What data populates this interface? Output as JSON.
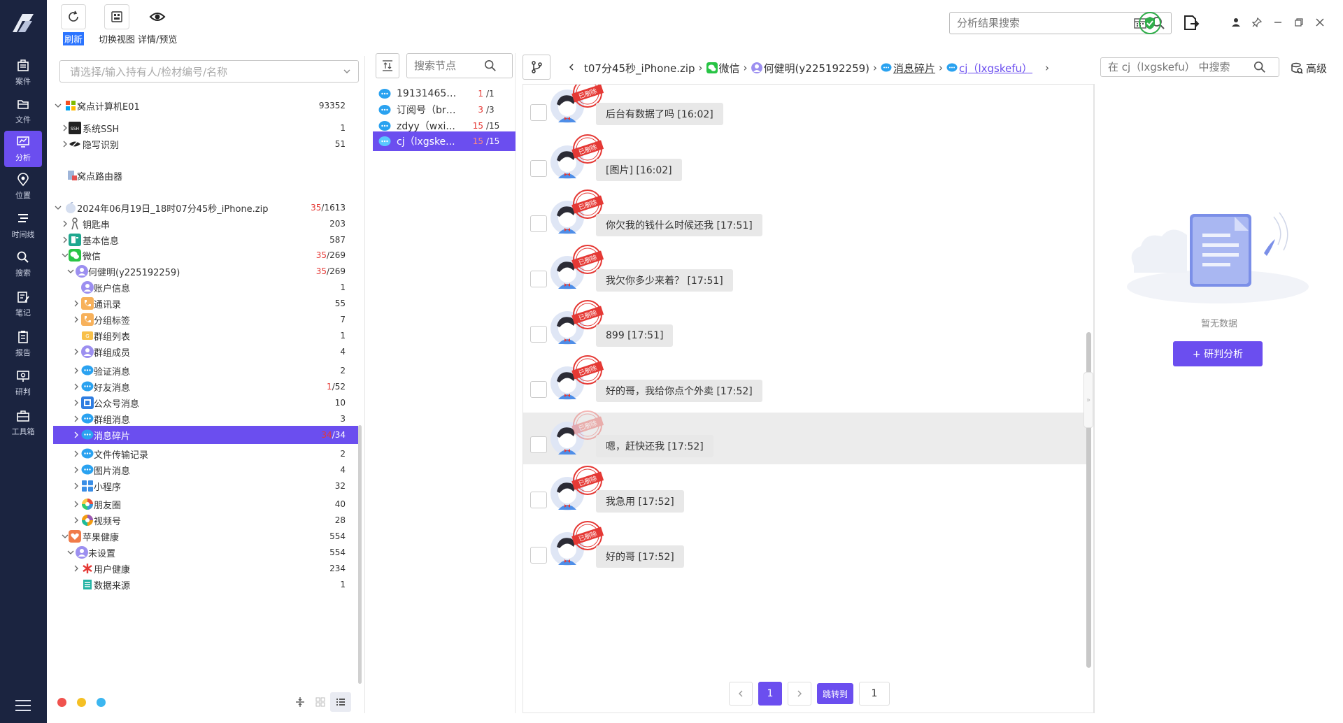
{
  "toolbar": {
    "refresh_label": "刷新",
    "switch_view_label": "切换视图",
    "detail_preview_label": "详情/预览",
    "result_search_placeholder": "分析结果搜索"
  },
  "nav": {
    "items": [
      {
        "label": "案件",
        "icon": "briefcase-icon"
      },
      {
        "label": "文件",
        "icon": "folder-icon"
      },
      {
        "label": "分析",
        "icon": "chart-monitor-icon"
      },
      {
        "label": "位置",
        "icon": "location-pin-icon"
      },
      {
        "label": "时间线",
        "icon": "timeline-icon"
      },
      {
        "label": "搜索",
        "icon": "search-icon"
      },
      {
        "label": "笔记",
        "icon": "note-icon"
      },
      {
        "label": "报告",
        "icon": "report-icon"
      },
      {
        "label": "研判",
        "icon": "analysis-icon"
      },
      {
        "label": "工具箱",
        "icon": "toolbox-icon"
      }
    ],
    "active_index": 2
  },
  "tree": {
    "selector_placeholder": "请选择/输入持有人/检材编号/名称",
    "nodes": [
      {
        "label": "窝点计算机E01",
        "count": "93352",
        "count_red": "",
        "icon": "windows-icon"
      },
      {
        "label": "系统SSH",
        "count": "1",
        "count_red": "",
        "icon": "ssh-icon"
      },
      {
        "label": "隐写识别",
        "count": "51",
        "count_red": "",
        "icon": "eye-slash-icon"
      },
      {
        "label": "窝点路由器",
        "count": "",
        "count_red": "",
        "icon": "router-icon"
      },
      {
        "label": "2024年06月19日_18时07分45秒_iPhone.zip",
        "count": "/1613",
        "count_red": "35",
        "icon": "apple-icon"
      },
      {
        "label": "钥匙串",
        "count": "203",
        "count_red": "",
        "icon": "keychain-icon"
      },
      {
        "label": "基本信息",
        "count": "587",
        "count_red": "",
        "icon": "info-card-icon"
      },
      {
        "label": "微信",
        "count": "/269",
        "count_red": "35",
        "icon": "wechat-icon"
      },
      {
        "label": "何健明(y225192259)",
        "count": "/269",
        "count_red": "35",
        "icon": "user-icon"
      },
      {
        "label": "账户信息",
        "count": "1",
        "count_red": "",
        "icon": "user-icon"
      },
      {
        "label": "通讯录",
        "count": "55",
        "count_red": "",
        "icon": "phone-book-icon"
      },
      {
        "label": "分组标签",
        "count": "7",
        "count_red": "",
        "icon": "tag-icon"
      },
      {
        "label": "群组列表",
        "count": "1",
        "count_red": "",
        "icon": "group-list-icon"
      },
      {
        "label": "群组成员",
        "count": "4",
        "count_red": "",
        "icon": "user-icon"
      },
      {
        "label": "验证消息",
        "count": "2",
        "count_red": "",
        "icon": "chat-bubble-icon"
      },
      {
        "label": "好友消息",
        "count": "/52",
        "count_red": "1",
        "icon": "chat-bubble-icon"
      },
      {
        "label": "公众号消息",
        "count": "10",
        "count_red": "",
        "icon": "official-account-icon"
      },
      {
        "label": "群组消息",
        "count": "3",
        "count_red": "",
        "icon": "chat-bubble-icon"
      },
      {
        "label": "消息碎片",
        "count": "/34",
        "count_red": "34",
        "icon": "chat-bubble-icon"
      },
      {
        "label": "文件传输记录",
        "count": "2",
        "count_red": "",
        "icon": "chat-bubble-icon"
      },
      {
        "label": "图片消息",
        "count": "4",
        "count_red": "",
        "icon": "chat-bubble-icon"
      },
      {
        "label": "小程序",
        "count": "32",
        "count_red": "",
        "icon": "mini-program-icon"
      },
      {
        "label": "朋友圈",
        "count": "40",
        "count_red": "",
        "icon": "moments-icon"
      },
      {
        "label": "视频号",
        "count": "28",
        "count_red": "",
        "icon": "channels-icon"
      },
      {
        "label": "苹果健康",
        "count": "554",
        "count_red": "",
        "icon": "health-icon"
      },
      {
        "label": "未设置",
        "count": "554",
        "count_red": "",
        "icon": "user-icon"
      },
      {
        "label": "用户健康",
        "count": "234",
        "count_red": "",
        "icon": "asterisk-icon"
      },
      {
        "label": "数据来源",
        "count": "1",
        "count_red": "",
        "icon": "data-source-icon"
      }
    ]
  },
  "node_list": {
    "search_placeholder": "搜索节点",
    "items": [
      {
        "name": "1913146561...",
        "red": "1",
        "total": "/1"
      },
      {
        "name": "订阅号（bra...",
        "red": "3",
        "total": "/3"
      },
      {
        "name": "zdyy（wxi...",
        "red": "15",
        "total": "/15"
      },
      {
        "name": "cj（lxgske...",
        "red": "15",
        "total": "/15"
      }
    ]
  },
  "breadcrumb": {
    "items": [
      "t07分45秒_iPhone.zip",
      "微信",
      "何健明(y225192259)",
      "消息碎片",
      "cj（lxgskefu）"
    ],
    "search_placeholder": "在 cj（lxgskefu） 中搜索",
    "advanced_label": "高级"
  },
  "messages": [
    {
      "text": "后台有数据了吗 [16:02]",
      "stamp": "已删除"
    },
    {
      "text": "[图片] [16:02]",
      "stamp": "已删除"
    },
    {
      "text": "你欠我的钱什么时候还我 [17:51]",
      "stamp": "已删除"
    },
    {
      "text": "我欠你多少来着？ [17:51]",
      "stamp": "已删除"
    },
    {
      "text": "899 [17:51]",
      "stamp": "已删除"
    },
    {
      "text": "好的哥，我给你点个外卖 [17:52]",
      "stamp": "已删除"
    },
    {
      "text": "嗯，赶快还我 [17:52]",
      "stamp": "已删除"
    },
    {
      "text": "我急用 [17:52]",
      "stamp": "已删除"
    },
    {
      "text": "好的哥 [17:52]",
      "stamp": "已删除"
    }
  ],
  "pager": {
    "current_page": "1",
    "jump_label": "跳转到",
    "jump_value": "1"
  },
  "right_panel": {
    "empty_text": "暂无数据",
    "analyze_label": "+ 研判分析"
  },
  "colors": {
    "accent": "#6b4eef",
    "rail": "#1b2440",
    "deleted_red": "#e53935"
  }
}
